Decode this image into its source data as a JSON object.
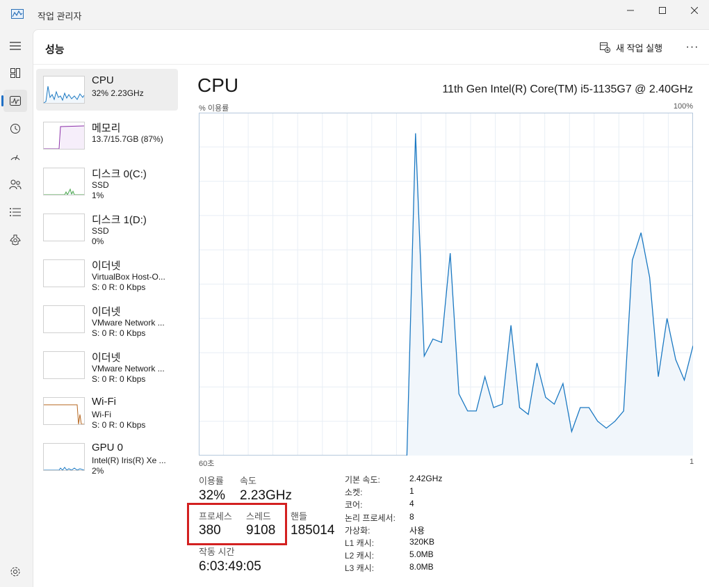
{
  "window": {
    "title": "작업 관리자"
  },
  "header": {
    "title": "성능",
    "run_task_label": "새 작업 실행",
    "more_label": "···"
  },
  "devices": [
    {
      "name": "CPU",
      "sub1": "32% 2.23GHz",
      "sub2": ""
    },
    {
      "name": "메모리",
      "sub1": "13.7/15.7GB (87%)",
      "sub2": ""
    },
    {
      "name": "디스크 0(C:)",
      "sub1": "SSD",
      "sub2": "1%"
    },
    {
      "name": "디스크 1(D:)",
      "sub1": "SSD",
      "sub2": "0%"
    },
    {
      "name": "이더넷",
      "sub1": "VirtualBox Host-O...",
      "sub2": "S: 0 R: 0 Kbps"
    },
    {
      "name": "이더넷",
      "sub1": "VMware Network ...",
      "sub2": "S: 0 R: 0 Kbps"
    },
    {
      "name": "이더넷",
      "sub1": "VMware Network ...",
      "sub2": "S: 0 R: 0 Kbps"
    },
    {
      "name": "Wi-Fi",
      "sub1": "Wi-Fi",
      "sub2": "S: 0 R: 0 Kbps"
    },
    {
      "name": "GPU 0",
      "sub1": "Intel(R) Iris(R) Xe ...",
      "sub2": "2%"
    }
  ],
  "detail": {
    "title": "CPU",
    "model": "11th Gen Intel(R) Core(TM) i5-1135G7 @ 2.40GHz",
    "graph_label_left": "% 이용률",
    "graph_label_right": "100%",
    "graph_bottom_left": "60초",
    "graph_bottom_right": "1",
    "usage_points": [
      0,
      0,
      0,
      0,
      0,
      0,
      0,
      0,
      0,
      0,
      0,
      0,
      0,
      0,
      0,
      0,
      0,
      0,
      0,
      0,
      0,
      0,
      0,
      0,
      0,
      94,
      29,
      34,
      33,
      59,
      18,
      13,
      13,
      23,
      14,
      15,
      38,
      14,
      12,
      27,
      17,
      15,
      21,
      7,
      14,
      14,
      10,
      8,
      10,
      13,
      57,
      65,
      52,
      23,
      40,
      28,
      22,
      32
    ],
    "stats": {
      "util_label": "이용률",
      "util_value": "32%",
      "speed_label": "속도",
      "speed_value": "2.23GHz",
      "proc_label": "프로세스",
      "proc_value": "380",
      "thread_label": "스레드",
      "thread_value": "9108",
      "handle_label": "핸들",
      "handle_value": "185014",
      "uptime_label": "작동 시간",
      "uptime_value": "6:03:49:05"
    },
    "specs": [
      {
        "key": "기본 속도:",
        "value": "2.42GHz"
      },
      {
        "key": "소켓:",
        "value": "1"
      },
      {
        "key": "코어:",
        "value": "4"
      },
      {
        "key": "논리 프로세서:",
        "value": "8"
      },
      {
        "key": "가상화:",
        "value": "사용"
      },
      {
        "key": "L1 캐시:",
        "value": "320KB"
      },
      {
        "key": "L2 캐시:",
        "value": "5.0MB"
      },
      {
        "key": "L3 캐시:",
        "value": "8.0MB"
      }
    ]
  },
  "colors": {
    "accent": "#1f6fc5",
    "cpu_line": "#1a78c2",
    "cpu_fill": "#f1f6fb",
    "mem_line": "#8b2fa8",
    "disk_line": "#4da84d",
    "wifi_line": "#b5651d",
    "highlight": "#d32020"
  }
}
